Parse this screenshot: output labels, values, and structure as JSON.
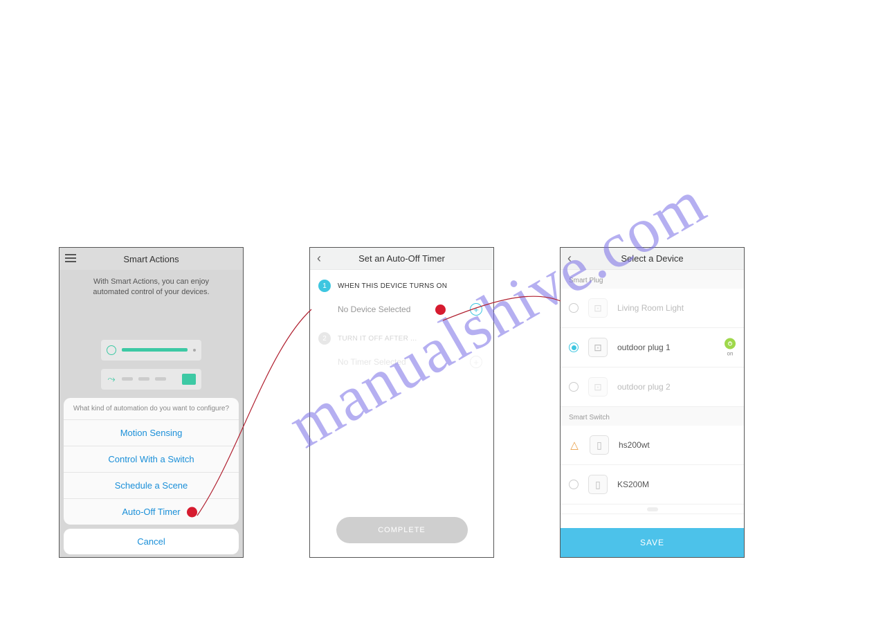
{
  "watermark": "manualshive.com",
  "screen1": {
    "title": "Smart Actions",
    "subtitle": "With Smart Actions, you can enjoy automated control of your devices.",
    "sheet_prompt": "What kind of automation do you want to configure?",
    "options": [
      "Motion Sensing",
      "Control With a Switch",
      "Schedule a Scene",
      "Auto-Off Timer"
    ],
    "cancel": "Cancel"
  },
  "screen2": {
    "title": "Set an Auto-Off Timer",
    "step1_label": "WHEN THIS DEVICE TURNS ON",
    "step1_value": "No Device Selected",
    "step1_num": "1",
    "step2_label": "TURN IT OFF AFTER ...",
    "step2_value": "No Timer Selected",
    "step2_num": "2",
    "complete": "COMPLETE"
  },
  "screen3": {
    "title": "Select a Device",
    "section1": "Smart Plug",
    "section2": "Smart Switch",
    "devices_plug": [
      {
        "name": "Living Room Light",
        "selected": false,
        "dimmed": true,
        "status": null
      },
      {
        "name": "outdoor plug 1",
        "selected": true,
        "dimmed": false,
        "status": "on"
      },
      {
        "name": "outdoor plug 2",
        "selected": false,
        "dimmed": true,
        "status": null
      }
    ],
    "devices_switch": [
      {
        "name": "hs200wt",
        "selected": false,
        "dimmed": false,
        "warn": true
      },
      {
        "name": "KS200M",
        "selected": false,
        "dimmed": false,
        "warn": false
      }
    ],
    "on_label": "on",
    "save": "SAVE"
  },
  "colors": {
    "accent_teal": "#3ec6e0",
    "accent_green": "#3dc9a4",
    "link_blue": "#1a8fd8",
    "red_dot": "#d61b2f",
    "save_blue": "#4cc2ea",
    "on_green": "#9fd84b"
  }
}
